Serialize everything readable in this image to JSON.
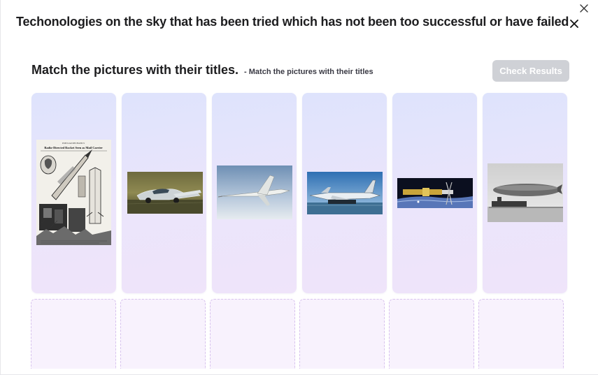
{
  "dialog": {
    "title": "Techonologies on the sky that has been tried which has not been too successful or have failed"
  },
  "exercise": {
    "heading": "Match the pictures with their titles.",
    "subheading": "- Match the pictures with their titles",
    "check_button_label": "Check Results",
    "check_button_enabled": false
  },
  "cards": [
    {
      "name": "rocket-mail-card",
      "image": "rocket-mail-magazine-page",
      "page_header": "POPULAR MECHANICS",
      "page_title": "Radio-Directed Rocket Seen as Mail Carrier"
    },
    {
      "name": "flying-car-card",
      "image": "flying-car-on-runway"
    },
    {
      "name": "supersonic-jet-card",
      "image": "supersonic-airliner-in-flight"
    },
    {
      "name": "ekranoplan-card",
      "image": "ground-effect-vehicle-on-water"
    },
    {
      "name": "spacecraft-card",
      "image": "nuclear-spacecraft-concept"
    },
    {
      "name": "airship-card",
      "image": "zeppelin-airship-over-water"
    }
  ],
  "drop_zones": 6,
  "colors": {
    "card_top": "#dee3fc",
    "card_bottom": "#efe4fa",
    "drop_zone_bg": "#f8f2fd",
    "drop_zone_border": "#d8c3ee",
    "button_disabled_bg": "#cfd1d6"
  }
}
